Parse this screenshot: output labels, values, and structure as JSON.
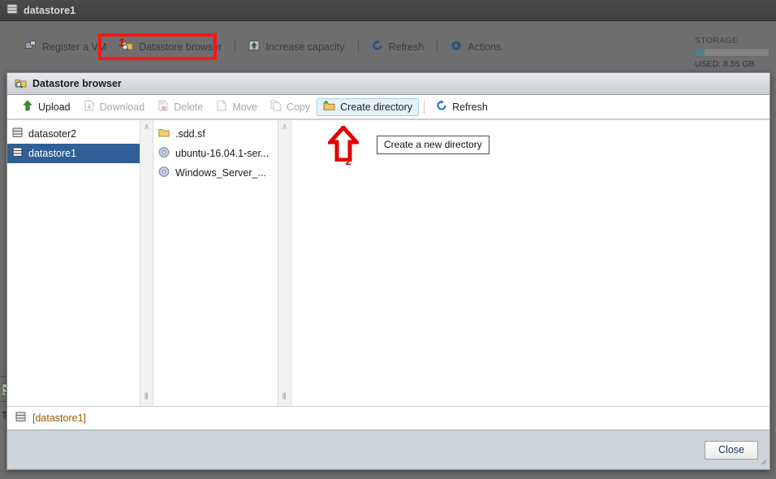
{
  "background": {
    "title": "datastore1",
    "title_icon": "datastore-icon",
    "toolbar": [
      {
        "id": "register-vm",
        "label": "Register a VM",
        "icon": "register-vm-icon",
        "sep_after": false
      },
      {
        "id": "datastore-browser",
        "label": "Datastore browser",
        "icon": "datastore-browser-icon",
        "sep_after": true
      },
      {
        "id": "increase-capacity",
        "label": "Increase capacity",
        "icon": "increase-capacity-icon",
        "sep_after": true
      },
      {
        "id": "refresh",
        "label": "Refresh",
        "icon": "refresh-icon",
        "sep_after": true
      },
      {
        "id": "actions",
        "label": "Actions",
        "icon": "gear-icon",
        "sep_after": false
      }
    ],
    "storage": {
      "label": "STORAGE",
      "used_text": "USED: 8.55 GB",
      "used_percent": 12,
      "bar_color": "#4a7f8c"
    },
    "peek_text": "T"
  },
  "dialog": {
    "title": "Datastore browser",
    "title_icon": "datastore-browser-icon",
    "toolbar": [
      {
        "id": "upload",
        "label": "Upload",
        "icon": "upload-icon",
        "state": "enabled",
        "sep_after": false
      },
      {
        "id": "download",
        "label": "Download",
        "icon": "download-icon",
        "state": "disabled",
        "sep_after": false
      },
      {
        "id": "delete",
        "label": "Delete",
        "icon": "delete-icon",
        "state": "disabled",
        "sep_after": false
      },
      {
        "id": "move",
        "label": "Move",
        "icon": "move-icon",
        "state": "disabled",
        "sep_after": false
      },
      {
        "id": "copy",
        "label": "Copy",
        "icon": "copy-icon",
        "state": "disabled",
        "sep_after": false
      },
      {
        "id": "create-directory",
        "label": "Create directory",
        "icon": "new-folder-icon",
        "state": "active",
        "sep_after": true
      },
      {
        "id": "refresh",
        "label": "Refresh",
        "icon": "refresh-icon",
        "state": "enabled",
        "sep_after": false
      }
    ],
    "datastores": [
      {
        "label": "datasoter2",
        "icon": "datastore-icon",
        "selected": false
      },
      {
        "label": "datastore1",
        "icon": "datastore-icon",
        "selected": true
      }
    ],
    "files": [
      {
        "label": ".sdd.sf",
        "icon": "folder-icon",
        "selected": false
      },
      {
        "label": "ubuntu-16.04.1-ser...",
        "icon": "iso-icon",
        "selected": false
      },
      {
        "label": "Windows_Server_...",
        "icon": "iso-icon",
        "selected": false
      }
    ],
    "status": {
      "path": "[datastore1]",
      "icon": "datastore-icon"
    },
    "close_label": "Close",
    "splitter_chevron": "∧",
    "splitter_grip": "⦀"
  },
  "annotations": {
    "step1_number": "1",
    "step2_number": "2",
    "tooltip_text": "Create a new directory",
    "highlight_color": "#ff1515",
    "arrow_color": "#e00000"
  }
}
